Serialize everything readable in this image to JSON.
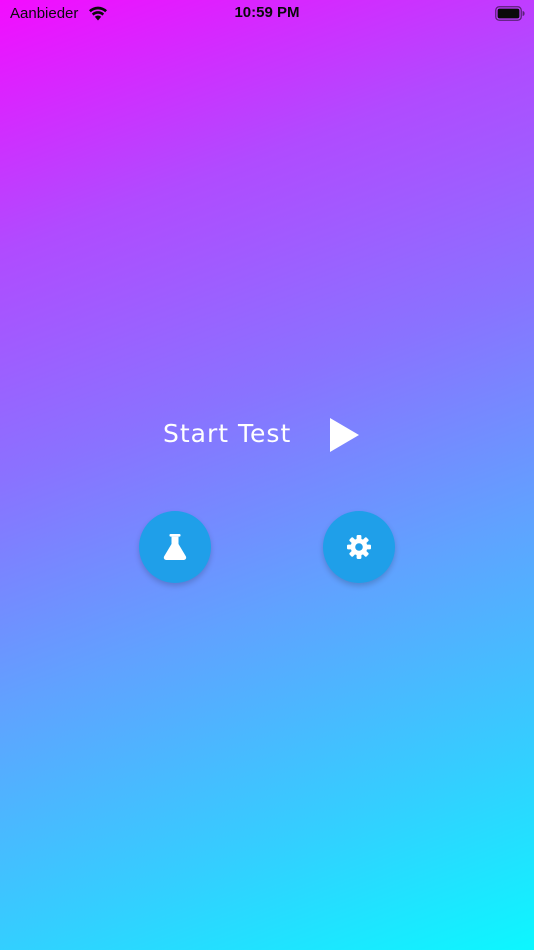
{
  "status_bar": {
    "carrier": "Aanbieder",
    "time": "10:59 PM",
    "wifi_icon": "wifi-icon",
    "battery_icon": "battery-icon"
  },
  "main": {
    "start_label": "Start Test",
    "start_icon": "play-icon"
  },
  "buttons": {
    "lab_icon": "flask-icon",
    "settings_icon": "gear-icon",
    "color": "#1f9fe9"
  },
  "theme": {
    "gradient_start": "#f40cff",
    "gradient_end": "#0cf7ff",
    "text_color": "#ffffff"
  }
}
